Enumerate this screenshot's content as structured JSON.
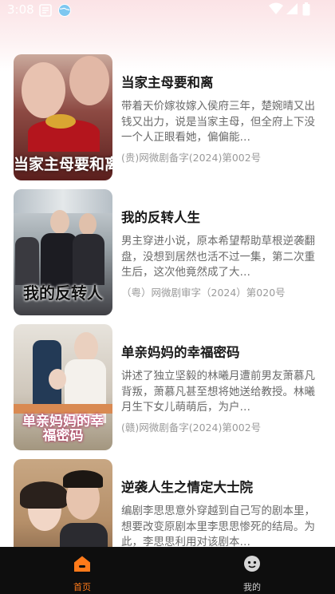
{
  "status_bar": {
    "time": "3:08"
  },
  "dramas": [
    {
      "title": "当家主母要和离",
      "description": "带着天价嫁妆嫁入侯府三年，楚婉晴又出钱又出力，说是当家主母，但全府上下没一个人正眼看她，偏偏能…",
      "license": "(贵)网微剧备字(2024)第002号",
      "poster_art_text": "当家主母要和离"
    },
    {
      "title": "我的反转人生",
      "description": "男主穿进小说，原本希望帮助草根逆袭翻盘，没想到居然也活不过一集，第二次重生后，这次他竟然成了大…",
      "license": "（粤）网微剧审字（2024）第020号",
      "poster_art_text": "我的反转人"
    },
    {
      "title": "单亲妈妈的幸福密码",
      "description": "讲述了独立坚毅的林曦月遭前男友萧慕凡背叛，萧慕凡甚至想将她送给教授。林曦月生下女儿萌萌后，为户…",
      "license": "(赣)网微剧备字(2024)第002号",
      "poster_art_text": "单亲妈妈的幸福密码"
    },
    {
      "title": "逆袭人生之情定大士院",
      "description": "编剧李思思意外穿越到自己写的剧本里，想要改变原剧本里李思思惨死的结局。为此，李思思利用对该剧本…",
      "license": "",
      "poster_art_text": ""
    }
  ],
  "tab_bar": {
    "home_label": "首页",
    "mine_label": "我的",
    "active_color": "#ff7a1a"
  },
  "colors": {
    "header_gradient_top": "#fbe3e6",
    "tab_bar_bg": "#0e0e0e"
  }
}
